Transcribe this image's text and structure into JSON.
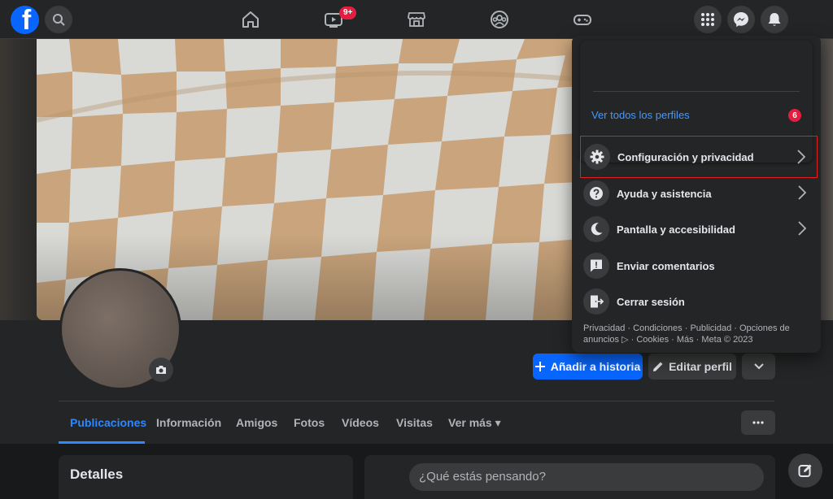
{
  "topbar": {
    "logo_letter": "f",
    "nav": [
      {
        "name": "home-icon"
      },
      {
        "name": "video-icon",
        "badge": "9+"
      },
      {
        "name": "marketplace-icon"
      },
      {
        "name": "groups-icon"
      },
      {
        "name": "gaming-icon"
      }
    ],
    "right": [
      "menu-grid-icon",
      "messenger-icon",
      "bell-icon"
    ]
  },
  "profile": {
    "add_story_label": "Añadir a historia",
    "edit_profile_label": "Editar perfil"
  },
  "tabs": [
    {
      "label": "Publicaciones",
      "active": true
    },
    {
      "label": "Información"
    },
    {
      "label": "Amigos"
    },
    {
      "label": "Fotos"
    },
    {
      "label": "Vídeos"
    },
    {
      "label": "Visitas"
    },
    {
      "label": "Ver más ▾"
    }
  ],
  "details": {
    "title": "Detalles"
  },
  "composer": {
    "placeholder": "¿Qué estás pensando?"
  },
  "menu": {
    "see_all_profiles": "Ver todos los perfiles",
    "see_all_count": "6",
    "items": [
      {
        "label": "Configuración y privacidad",
        "icon": "gear-icon",
        "chevron": true,
        "highlighted": true
      },
      {
        "label": "Ayuda y asistencia",
        "icon": "help-icon",
        "chevron": true
      },
      {
        "label": "Pantalla y accesibilidad",
        "icon": "moon-icon",
        "chevron": true
      },
      {
        "label": "Enviar comentarios",
        "icon": "feedback-icon",
        "chevron": false
      },
      {
        "label": "Cerrar sesión",
        "icon": "logout-icon",
        "chevron": false
      }
    ],
    "footer": "Privacidad · Condiciones · Publicidad · Opciones de anuncios ▷ · Cookies · Más · Meta © 2023"
  },
  "colors": {
    "accent": "#0866ff",
    "link": "#4599ff",
    "badge": "#e41e3f",
    "highlight_border": "#e02020",
    "cover_tan": "#c9a47c",
    "cover_white": "#d9d9d6"
  }
}
